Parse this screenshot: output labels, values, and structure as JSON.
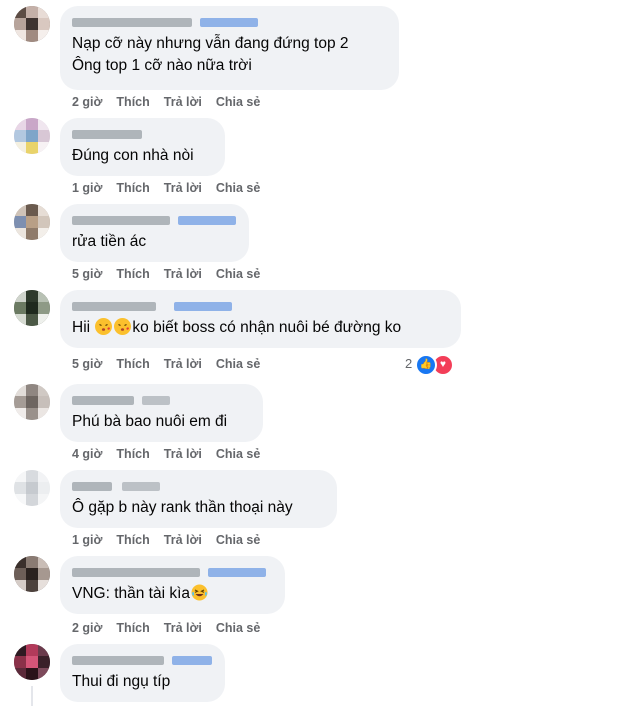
{
  "comments": [
    {
      "lines": [
        "Nạp cỡ này nhưng vẫn đang đứng top 2",
        "Ông top 1 cỡ nào nữa trời"
      ],
      "time": "2 giờ",
      "like": "Thích",
      "reply": "Trả lời",
      "share": "Chia sẻ"
    },
    {
      "lines": [
        "Đúng con nhà nòi"
      ],
      "time": "1 giờ",
      "like": "Thích",
      "reply": "Trả lời",
      "share": "Chia sẻ"
    },
    {
      "lines": [
        "rửa tiền ác"
      ],
      "time": "5 giờ",
      "like": "Thích",
      "reply": "Trả lời",
      "share": "Chia sẻ"
    },
    {
      "lines": [
        "Hii ",
        "ko biết boss có nhận nuôi bé đường ko"
      ],
      "time": "5 giờ",
      "like": "Thích",
      "reply": "Trả lời",
      "share": "Chia sẻ",
      "reaction_count": "2"
    },
    {
      "lines": [
        "Phú bà bao nuôi em đi"
      ],
      "time": "4 giờ",
      "like": "Thích",
      "reply": "Trả lời",
      "share": "Chia sẻ"
    },
    {
      "lines": [
        "Ô gặp b này rank thần thoại này"
      ],
      "time": "1 giờ",
      "like": "Thích",
      "reply": "Trả lời",
      "share": "Chia sẻ"
    },
    {
      "lines": [
        "VNG: thần tài kìa"
      ],
      "time": "2 giờ",
      "like": "Thích",
      "reply": "Trả lời",
      "share": "Chia sẻ"
    },
    {
      "lines": [
        "Thui đi ngụ típ"
      ]
    }
  ],
  "icons": {
    "like": "like-reaction-icon",
    "love": "love-reaction-icon",
    "kiss": "kiss-emoji-icon",
    "laugh": "laugh-emoji-icon"
  },
  "colors": {
    "bubble": "#f0f2f5",
    "meta": "#65676b",
    "like": "#1877f2",
    "love": "#f33e58"
  }
}
